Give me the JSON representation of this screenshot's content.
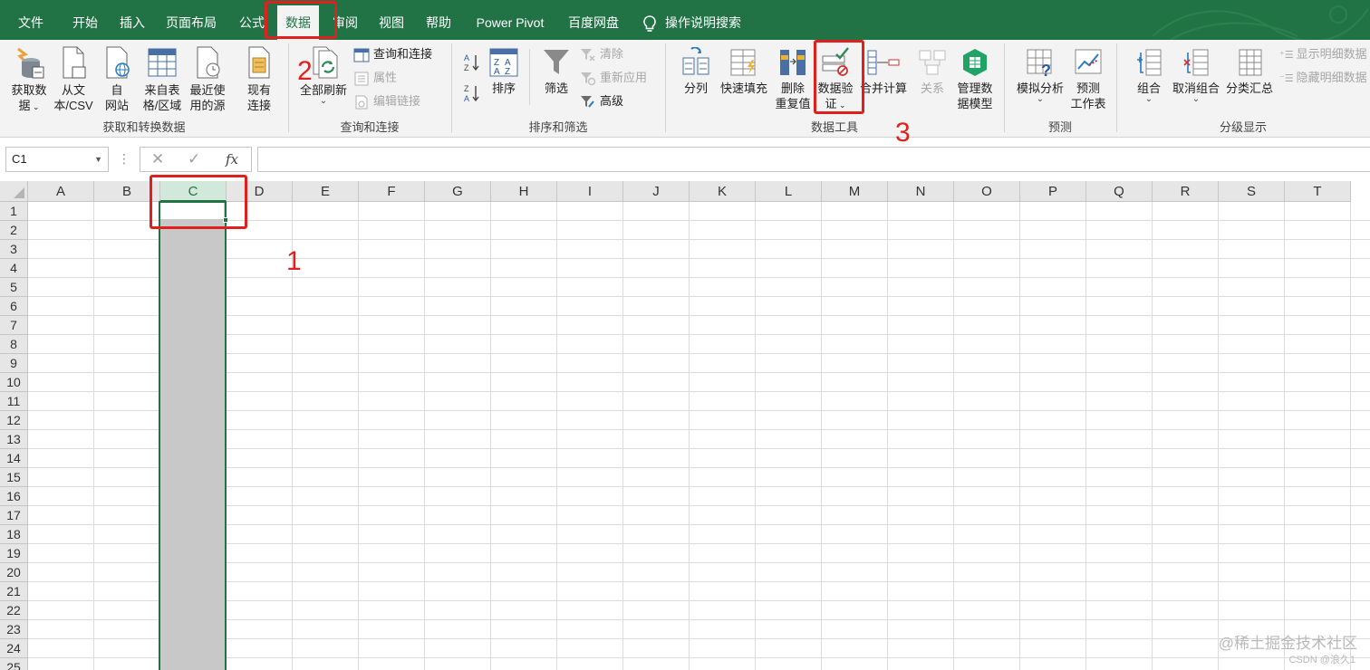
{
  "tabs": [
    {
      "label": "文件",
      "name": "tab-file"
    },
    {
      "label": "开始",
      "name": "tab-home"
    },
    {
      "label": "插入",
      "name": "tab-insert"
    },
    {
      "label": "页面布局",
      "name": "tab-page-layout"
    },
    {
      "label": "公式",
      "name": "tab-formulas"
    },
    {
      "label": "数据",
      "name": "tab-data",
      "active": true
    },
    {
      "label": "审阅",
      "name": "tab-review"
    },
    {
      "label": "视图",
      "name": "tab-view"
    },
    {
      "label": "帮助",
      "name": "tab-help"
    },
    {
      "label": "Power Pivot",
      "name": "tab-power-pivot"
    },
    {
      "label": "百度网盘",
      "name": "tab-baidu-netdisk"
    }
  ],
  "tell_me": {
    "label": "操作说明搜索",
    "icon": "lightbulb-icon"
  },
  "ribbon": {
    "get_data": {
      "get_data": {
        "line1": "获取数",
        "line2": "据"
      },
      "from_text": {
        "line1": "从文",
        "line2": "本/CSV"
      },
      "from_web": {
        "line1": "自",
        "line2": "网站"
      },
      "from_table": {
        "line1": "来自表",
        "line2": "格/区域"
      },
      "recent_sources": {
        "line1": "最近使",
        "line2": "用的源"
      },
      "existing_connections": {
        "line1": "现有",
        "line2": "连接"
      },
      "group_label": "获取和转换数据"
    },
    "queries": {
      "refresh_all": {
        "label": "全部刷新"
      },
      "queries_connections": "查询和连接",
      "properties": "属性",
      "edit_links": "编辑链接",
      "group_label": "查询和连接"
    },
    "sort_filter": {
      "sort": "排序",
      "filter": "筛选",
      "clear": "清除",
      "reapply": "重新应用",
      "advanced": "高级",
      "group_label": "排序和筛选"
    },
    "data_tools": {
      "text_to_columns": "分列",
      "flash_fill": "快速填充",
      "remove_duplicates": {
        "line1": "删除",
        "line2": "重复值"
      },
      "data_validation": {
        "line1": "数据验",
        "line2": "证"
      },
      "consolidate": "合并计算",
      "relationships": "关系",
      "manage_data_model": {
        "line1": "管理数",
        "line2": "据模型"
      },
      "group_label": "数据工具"
    },
    "forecast": {
      "what_if": "模拟分析",
      "forecast_sheet": {
        "line1": "预测",
        "line2": "工作表"
      },
      "group_label": "预测"
    },
    "outline": {
      "group": "组合",
      "ungroup": "取消组合",
      "subtotal": "分类汇总",
      "show_detail": "显示明细数据",
      "hide_detail": "隐藏明细数据",
      "group_label": "分级显示"
    }
  },
  "formula_bar": {
    "name_box": "C1",
    "cancel": "✕",
    "enter": "✓",
    "fx": "fx",
    "value": ""
  },
  "sheet": {
    "columns": [
      "A",
      "B",
      "C",
      "D",
      "E",
      "F",
      "G",
      "H",
      "I",
      "J",
      "K",
      "L",
      "M",
      "N",
      "O",
      "P",
      "Q",
      "R",
      "S",
      "T"
    ],
    "rows": [
      "1",
      "2",
      "3",
      "4",
      "5",
      "6",
      "7",
      "8",
      "9",
      "10",
      "11",
      "12",
      "13",
      "14",
      "15",
      "16",
      "17",
      "18",
      "19",
      "20",
      "21",
      "22",
      "23",
      "24",
      "25"
    ],
    "selected_column": "C",
    "active_cell": "C1"
  },
  "annotations": {
    "step1": "1",
    "step2": "2",
    "step3": "3"
  },
  "watermark": {
    "line1": "@稀土掘金技术社区",
    "line2": "CSDN @浪久1"
  },
  "colors": {
    "accent": "#217346",
    "annotation": "#e0201c",
    "selection": "#c8c8c8"
  }
}
